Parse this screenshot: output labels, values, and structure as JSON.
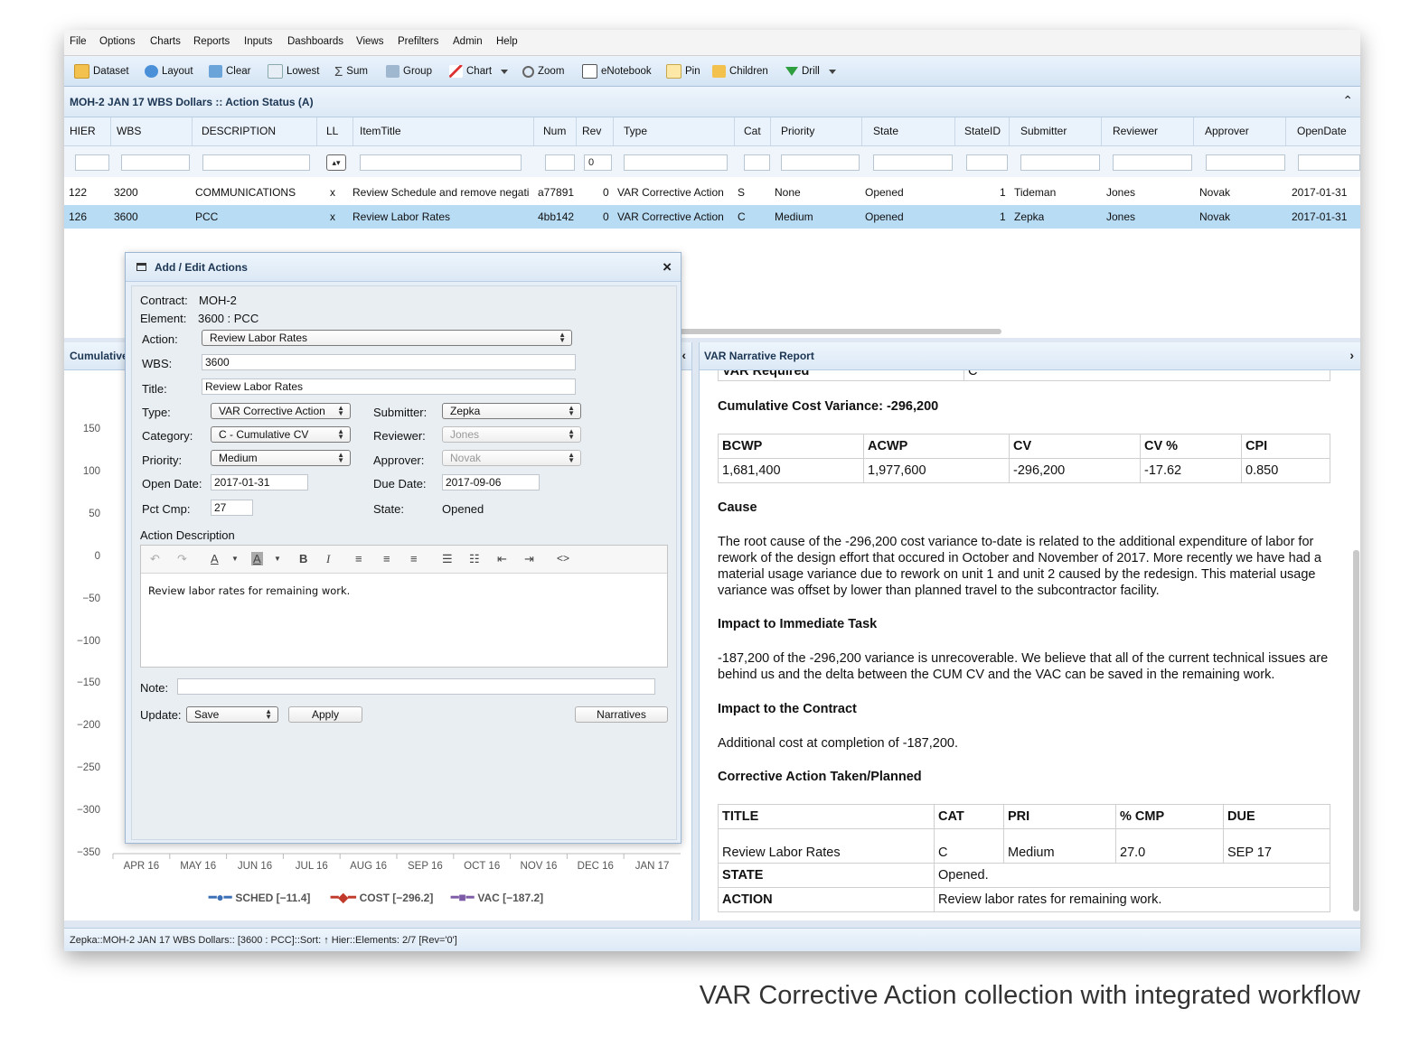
{
  "menu": [
    "File",
    "Options",
    "Charts",
    "Reports",
    "Inputs",
    "Dashboards",
    "Views",
    "Prefilters",
    "Admin",
    "Help"
  ],
  "toolbar": {
    "dataset": "Dataset",
    "layout": "Layout",
    "clear": "Clear",
    "lowest": "Lowest",
    "sum": "Sum",
    "group": "Group",
    "chart": "Chart",
    "zoom": "Zoom",
    "enotebook": "eNotebook",
    "pin": "Pin",
    "children": "Children",
    "drill": "Drill"
  },
  "grid": {
    "title": "MOH-2 JAN 17 WBS Dollars :: Action Status (A)",
    "columns": [
      "HIER",
      "WBS",
      "DESCRIPTION",
      "LL",
      "ItemTitle",
      "Num",
      "Rev",
      "Type",
      "Cat",
      "Priority",
      "State",
      "StateID",
      "Submitter",
      "Reviewer",
      "Approver",
      "OpenDate"
    ],
    "filter_rev": "0",
    "rows": [
      {
        "hier": "122",
        "wbs": "3200",
        "desc": "COMMUNICATIONS",
        "ll": "x",
        "title": "Review Schedule and remove negati",
        "num": "a77891",
        "rev": "0",
        "type": "VAR Corrective Action",
        "cat": "S",
        "priority": "None",
        "state": "Opened",
        "stateid": "1",
        "submitter": "Tideman",
        "reviewer": "Jones",
        "approver": "Novak",
        "opendate": "2017-01-31"
      },
      {
        "hier": "126",
        "wbs": "3600",
        "desc": "PCC",
        "ll": "x",
        "title": "Review Labor Rates",
        "num": "4bb142",
        "rev": "0",
        "type": "VAR Corrective Action",
        "cat": "C",
        "priority": "Medium",
        "state": "Opened",
        "stateid": "1",
        "submitter": "Zepka",
        "reviewer": "Jones",
        "approver": "Novak",
        "opendate": "2017-01-31"
      }
    ]
  },
  "left_panel": {
    "title": "Cumulative",
    "chart_data": {
      "type": "line",
      "categories": [
        "APR 16",
        "MAY 16",
        "JUN 16",
        "JUL 16",
        "AUG 16",
        "SEP 16",
        "OCT 16",
        "NOV 16",
        "DEC 16",
        "JAN 17"
      ],
      "yticks": [
        "150",
        "100",
        "50",
        "0",
        "−50",
        "−100",
        "−150",
        "−200",
        "−250",
        "−300",
        "−350"
      ],
      "ylim": [
        -350,
        150
      ],
      "series": [
        {
          "name": "SCHED [−11.4]",
          "color": "#3b6fb6"
        },
        {
          "name": "COST [−296.2]",
          "color": "#c0392b"
        },
        {
          "name": "VAC [−187.2]",
          "color": "#7d5ba6"
        }
      ]
    }
  },
  "dialog": {
    "title": "Add / Edit Actions",
    "contract_label": "Contract:",
    "contract_value": "MOH-2",
    "element_label": "Element:",
    "element_value": "3600 : PCC",
    "action_label": "Action:",
    "action_value": "Review Labor Rates",
    "wbs_label": "WBS:",
    "wbs_value": "3600",
    "title_label": "Title:",
    "title_value": "Review Labor Rates",
    "type_label": "Type:",
    "type_value": "VAR Corrective Action",
    "category_label": "Category:",
    "category_value": "C - Cumulative CV",
    "priority_label": "Priority:",
    "priority_value": "Medium",
    "open_label": "Open Date:",
    "open_value": "2017-01-31",
    "pct_label": "Pct Cmp:",
    "pct_value": "27",
    "submitter_label": "Submitter:",
    "submitter_value": "Zepka",
    "reviewer_label": "Reviewer:",
    "reviewer_value": "Jones",
    "approver_label": "Approver:",
    "approver_value": "Novak",
    "due_label": "Due Date:",
    "due_value": "2017-09-06",
    "state_label": "State:",
    "state_value": "Opened",
    "desc_label": "Action Description",
    "desc_text": "Review labor rates for remaining work.",
    "note_label": "Note:",
    "update_label": "Update:",
    "update_value": "Save",
    "apply": "Apply",
    "narratives": "Narratives"
  },
  "narrative": {
    "title": "VAR Narrative Report",
    "var_required": "VAR Required",
    "var_required_value": "C",
    "cum_heading": "Cumulative Cost Variance: -296,200",
    "cost_table": {
      "headers": [
        "BCWP",
        "ACWP",
        "CV",
        "CV %",
        "CPI"
      ],
      "values": [
        "1,681,400",
        "1,977,600",
        "-296,200",
        "-17.62",
        "0.850"
      ]
    },
    "cause_heading": "Cause",
    "cause_text": "The root cause of the -296,200 cost variance to-date is related to the additional expenditure of labor for rework of the design effort that occured in October and November of 2017. More recently we have had a material usage variance due to rework on unit 1 and unit 2 caused by the redesign. This material usage variance was offset by lower than planned travel to the subcontractor facility.",
    "task_heading": "Impact to Immediate Task",
    "task_text": "-187,200 of the -296,200 variance is unrecoverable. We believe that all of the current technical issues are behind us and the delta between the CUM CV and the VAC can be saved in the remaining work.",
    "contract_heading": "Impact to the Contract",
    "contract_text": "Additional cost at completion of -187,200.",
    "corrective_heading": "Corrective Action Taken/Planned",
    "action_table": {
      "headers": [
        "TITLE",
        "CAT",
        "PRI",
        "% CMP",
        "DUE"
      ],
      "values": [
        "Review Labor Rates",
        "C",
        "Medium",
        "27.0",
        "SEP 17"
      ],
      "state_label": "STATE",
      "state_value": "Opened.",
      "action_label": "ACTION",
      "action_value": "Review labor rates for remaining work."
    }
  },
  "status_bar": "Zepka::MOH-2 JAN 17 WBS Dollars:: [3600 : PCC]::Sort: ↑ Hier::Elements: 2/7 [Rev='0']",
  "caption": "VAR Corrective Action collection with integrated workflow"
}
